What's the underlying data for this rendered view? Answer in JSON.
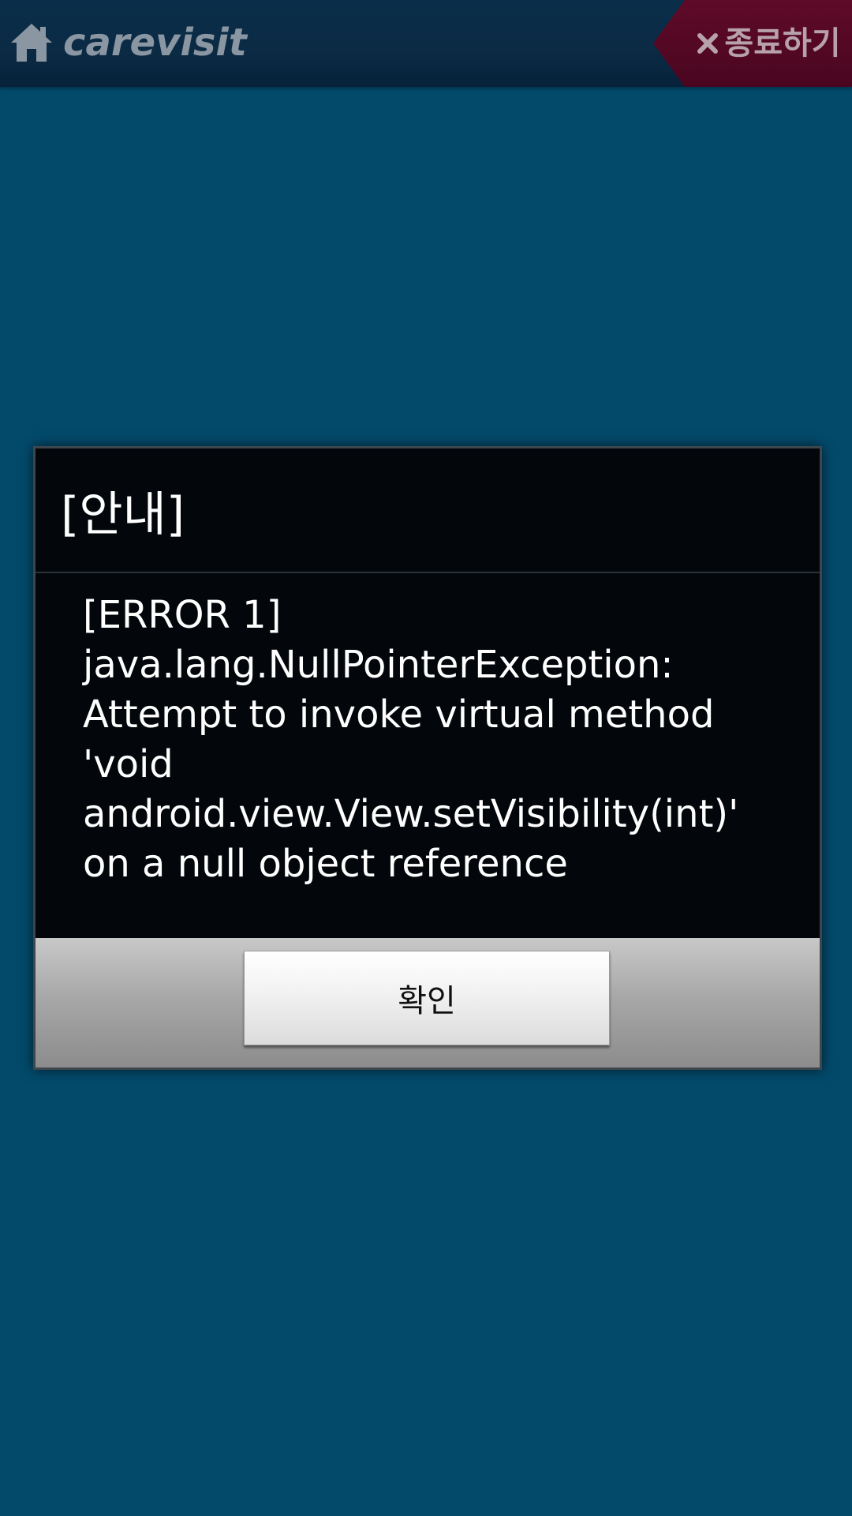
{
  "app": {
    "logo_text": "carevisit",
    "home_icon": "home-icon",
    "exit_label": "종료하기",
    "exit_icon": "close-x-icon"
  },
  "dialog": {
    "title": "[안내]",
    "message": "[ERROR 1]\njava.lang.NullPointerException:\nAttempt to invoke virtual method\n'void\nandroid.view.View.setVisibility(int)'\non a null object reference",
    "confirm_label": "확인"
  },
  "colors": {
    "background": "#03496a",
    "topbar": "#0b2a44",
    "exit_button": "#5e0a28",
    "dialog_background": "#03070b",
    "dialog_footer": "#a8a8a8"
  }
}
